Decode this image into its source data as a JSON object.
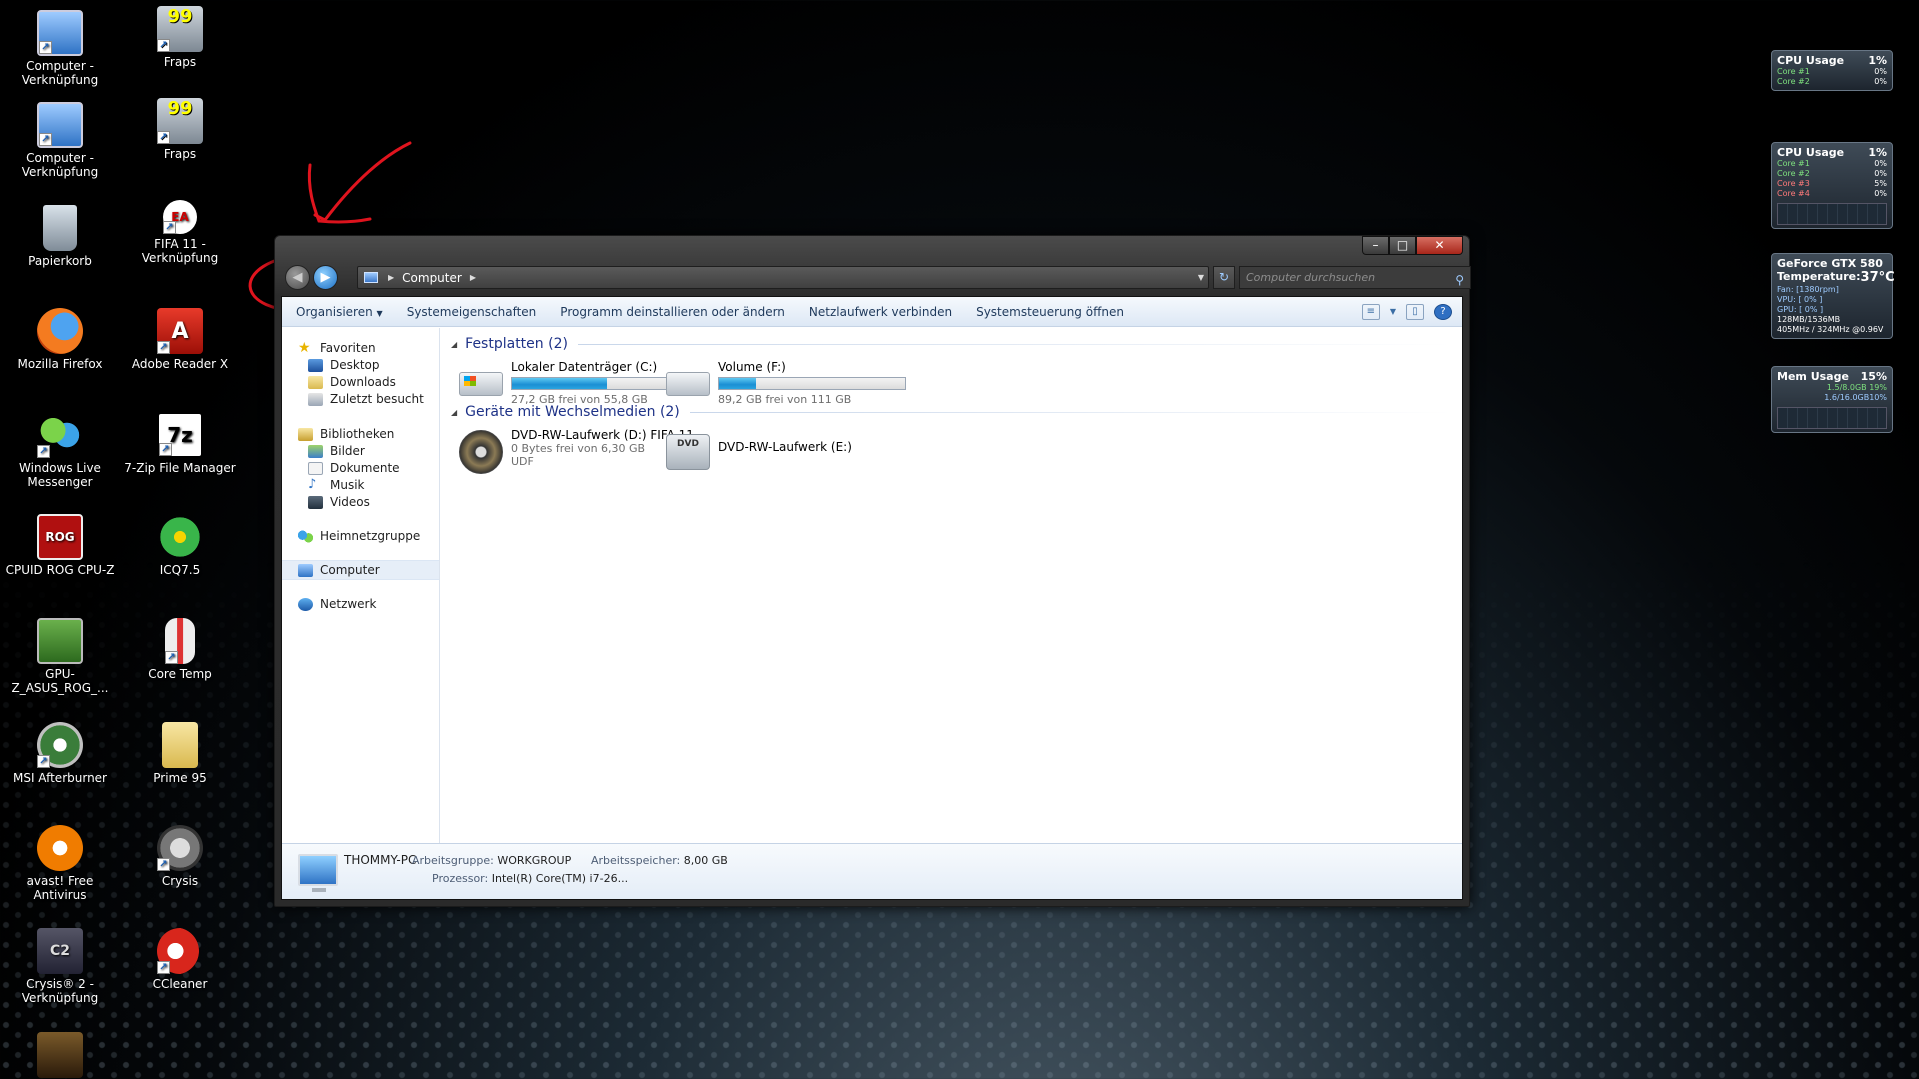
{
  "desktop": {
    "icons": [
      {
        "label": "Computer - Verknüpfung"
      },
      {
        "label": "Fraps"
      },
      {
        "label": "Computer - Verknüpfung"
      },
      {
        "label": "Fraps"
      },
      {
        "label": "Papierkorb"
      },
      {
        "label": "FIFA 11 - Verknüpfung"
      },
      {
        "label": "Mozilla Firefox"
      },
      {
        "label": "Adobe Reader X"
      },
      {
        "label": "Windows Live Messenger"
      },
      {
        "label": "7-Zip File Manager"
      },
      {
        "label": "CPUID ROG CPU-Z"
      },
      {
        "label": "ICQ7.5"
      },
      {
        "label": "GPU-Z_ASUS_ROG_..."
      },
      {
        "label": "Core Temp"
      },
      {
        "label": "MSI Afterburner"
      },
      {
        "label": "Prime 95"
      },
      {
        "label": "avast! Free Antivirus"
      },
      {
        "label": "Crysis"
      },
      {
        "label": "Crysis® 2 - Verknüpfung"
      },
      {
        "label": "CCleaner"
      }
    ]
  },
  "explorer": {
    "address": {
      "path": "Computer"
    },
    "search_placeholder": "Computer durchsuchen",
    "toolbar": {
      "organize": "Organisieren",
      "system_properties": "Systemeigenschaften",
      "uninstall": "Programm deinstallieren oder ändern",
      "map_drive": "Netzlaufwerk verbinden",
      "control_panel": "Systemsteuerung öffnen"
    },
    "nav": {
      "favorites": "Favoriten",
      "desktop": "Desktop",
      "downloads": "Downloads",
      "recent": "Zuletzt besucht",
      "libraries": "Bibliotheken",
      "pictures": "Bilder",
      "documents": "Dokumente",
      "music": "Musik",
      "videos": "Videos",
      "homegroup": "Heimnetzgruppe",
      "computer": "Computer",
      "network": "Netzwerk"
    },
    "groups": {
      "hard_disks": "Festplatten (2)",
      "removable": "Geräte mit Wechselmedien (2)"
    },
    "drives": {
      "c": {
        "name": "Lokaler Datenträger (C:)",
        "free": "27,2 GB frei von 55,8 GB",
        "used_fraction": 0.51
      },
      "f": {
        "name": "Volume (F:)",
        "free": "89,2 GB frei von 111 GB",
        "used_fraction": 0.2
      },
      "d": {
        "name": "DVD-RW-Laufwerk (D:) FIFA 11",
        "free": "0 Bytes frei von 6,30 GB",
        "fs": "UDF"
      },
      "e": {
        "name": "DVD-RW-Laufwerk (E:)",
        "badge": "DVD"
      }
    },
    "details": {
      "pc_name": "THOMMY-PC",
      "workgroup_label": "Arbeitsgruppe:",
      "workgroup": "WORKGROUP",
      "memory_label": "Arbeitsspeicher:",
      "memory": "8,00 GB",
      "cpu_label": "Prozessor:",
      "cpu": "Intel(R) Core(TM) i7-26..."
    }
  },
  "gadgets": {
    "cpu1": {
      "title": "CPU Usage",
      "value": "1%",
      "cores": [
        {
          "k": "Core #1",
          "v": "0%"
        },
        {
          "k": "Core #2",
          "v": "0%"
        }
      ]
    },
    "cpu2": {
      "title": "CPU Usage",
      "value": "1%",
      "cores": [
        {
          "k": "Core #1",
          "v": "0%"
        },
        {
          "k": "Core #2",
          "v": "0%"
        },
        {
          "k": "Core #3",
          "v": "5%"
        },
        {
          "k": "Core #4",
          "v": "0%"
        }
      ]
    },
    "gpu": {
      "title": "GeForce GTX 580",
      "temp_label": "Temperature:",
      "temp": "37°C",
      "fan": "Fan: [1380rpm]",
      "vpu": "VPU: [ 0% ]",
      "gpu": "GPU: [ 0% ]",
      "mem": "128MB/1536MB",
      "clock": "405MHz / 324MHz @0.96V"
    },
    "mem": {
      "title": "Mem Usage",
      "value": "15%",
      "r1": "1.5/8.0GB 19%",
      "r2": "1.6/16.0GB10%"
    }
  },
  "colors": {
    "accent": "#1b8fd4",
    "annotation": "#e0141e"
  }
}
